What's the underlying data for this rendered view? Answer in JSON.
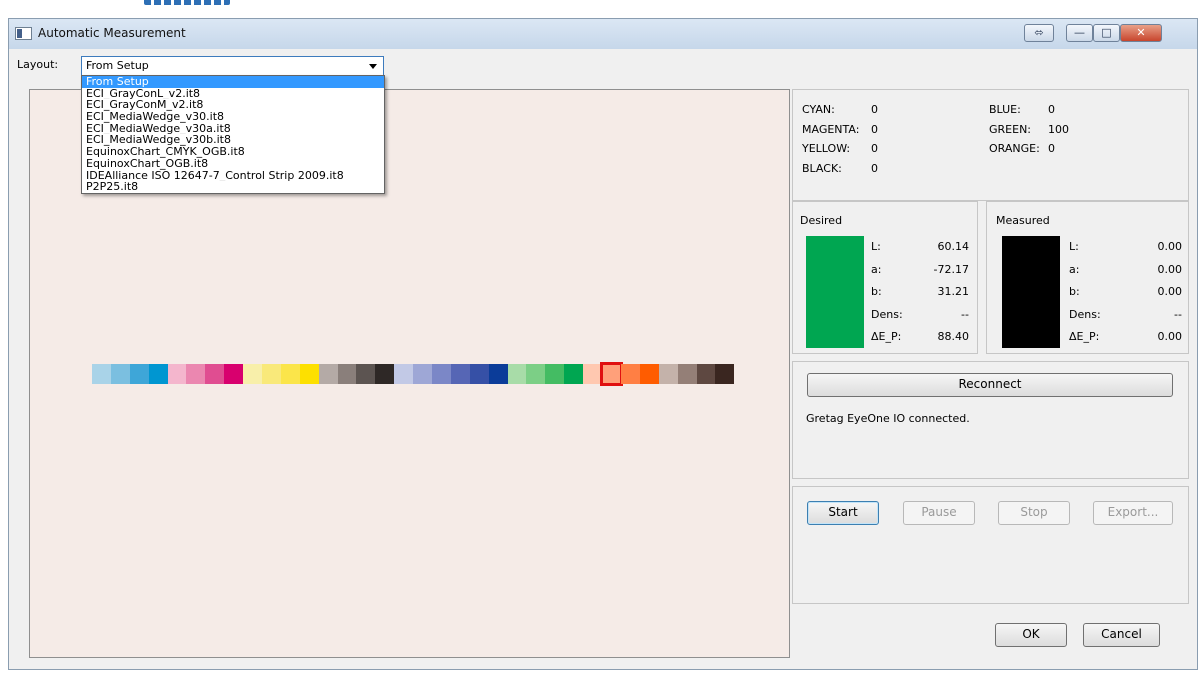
{
  "window": {
    "title": "Automatic Measurement",
    "controls": [
      "⬄",
      "—",
      "□",
      "✕"
    ]
  },
  "layout": {
    "label": "Layout:",
    "selected": "From Setup",
    "options": [
      "From Setup",
      "ECI_GrayConL_v2.it8",
      "ECI_GrayConM_v2.it8",
      "ECI_MediaWedge_v30.it8",
      "ECI_MediaWedge_v30a.it8",
      "ECI_MediaWedge_v30b.it8",
      "EquinoxChart_CMYK_OGB.it8",
      "EquinoxChart_OGB.it8",
      "IDEAlliance ISO 12647-7_Control Strip 2009.it8",
      "P2P25.it8"
    ]
  },
  "colorants": {
    "left": [
      {
        "name": "CYAN:",
        "value": "0"
      },
      {
        "name": "MAGENTA:",
        "value": "0"
      },
      {
        "name": "YELLOW:",
        "value": "0"
      },
      {
        "name": "BLACK:",
        "value": "0"
      }
    ],
    "right": [
      {
        "name": "BLUE:",
        "value": "0"
      },
      {
        "name": "GREEN:",
        "value": "100"
      },
      {
        "name": "ORANGE:",
        "value": "0"
      }
    ]
  },
  "desired": {
    "title": "Desired",
    "color": "#00a651",
    "rows": [
      {
        "label": "L:",
        "value": "60.14"
      },
      {
        "label": "a:",
        "value": "-72.17"
      },
      {
        "label": "b:",
        "value": "31.21"
      },
      {
        "label": "Dens:",
        "value": "--"
      },
      {
        "label": "ΔE_P:",
        "value": "88.40"
      }
    ]
  },
  "measured": {
    "title": "Measured",
    "color": "#000000",
    "rows": [
      {
        "label": "L:",
        "value": "0.00"
      },
      {
        "label": "a:",
        "value": "0.00"
      },
      {
        "label": "b:",
        "value": "0.00"
      },
      {
        "label": "Dens:",
        "value": "--"
      },
      {
        "label": "ΔE_P:",
        "value": "0.00"
      }
    ]
  },
  "device": {
    "reconnect_label": "Reconnect",
    "status": "Gretag EyeOne IO connected."
  },
  "controls": {
    "start": "Start",
    "pause": "Pause",
    "stop": "Stop",
    "export": "Export..."
  },
  "footer": {
    "ok": "OK",
    "cancel": "Cancel"
  },
  "strip": {
    "selected_index": 27,
    "patches": [
      "#a9d3e8",
      "#7bbfe0",
      "#3ea6d8",
      "#0096d1",
      "#f4b6cd",
      "#eb87b0",
      "#e04d91",
      "#d8006e",
      "#f8efaa",
      "#f9e97a",
      "#fbe54a",
      "#fde000",
      "#b4aaa6",
      "#8a7f7b",
      "#5c5451",
      "#2e2826",
      "#c2c9e6",
      "#9ea7d6",
      "#7b87c7",
      "#5666b5",
      "#3650a6",
      "#0b3c99",
      "#a8dca8",
      "#7ccf86",
      "#44bc63",
      "#00a651",
      "#ffc8b0",
      "#ffa07a",
      "#ff7f44",
      "#ff5c00",
      "#c4b2aa",
      "#947f77",
      "#5e4841",
      "#3a2620"
    ]
  }
}
